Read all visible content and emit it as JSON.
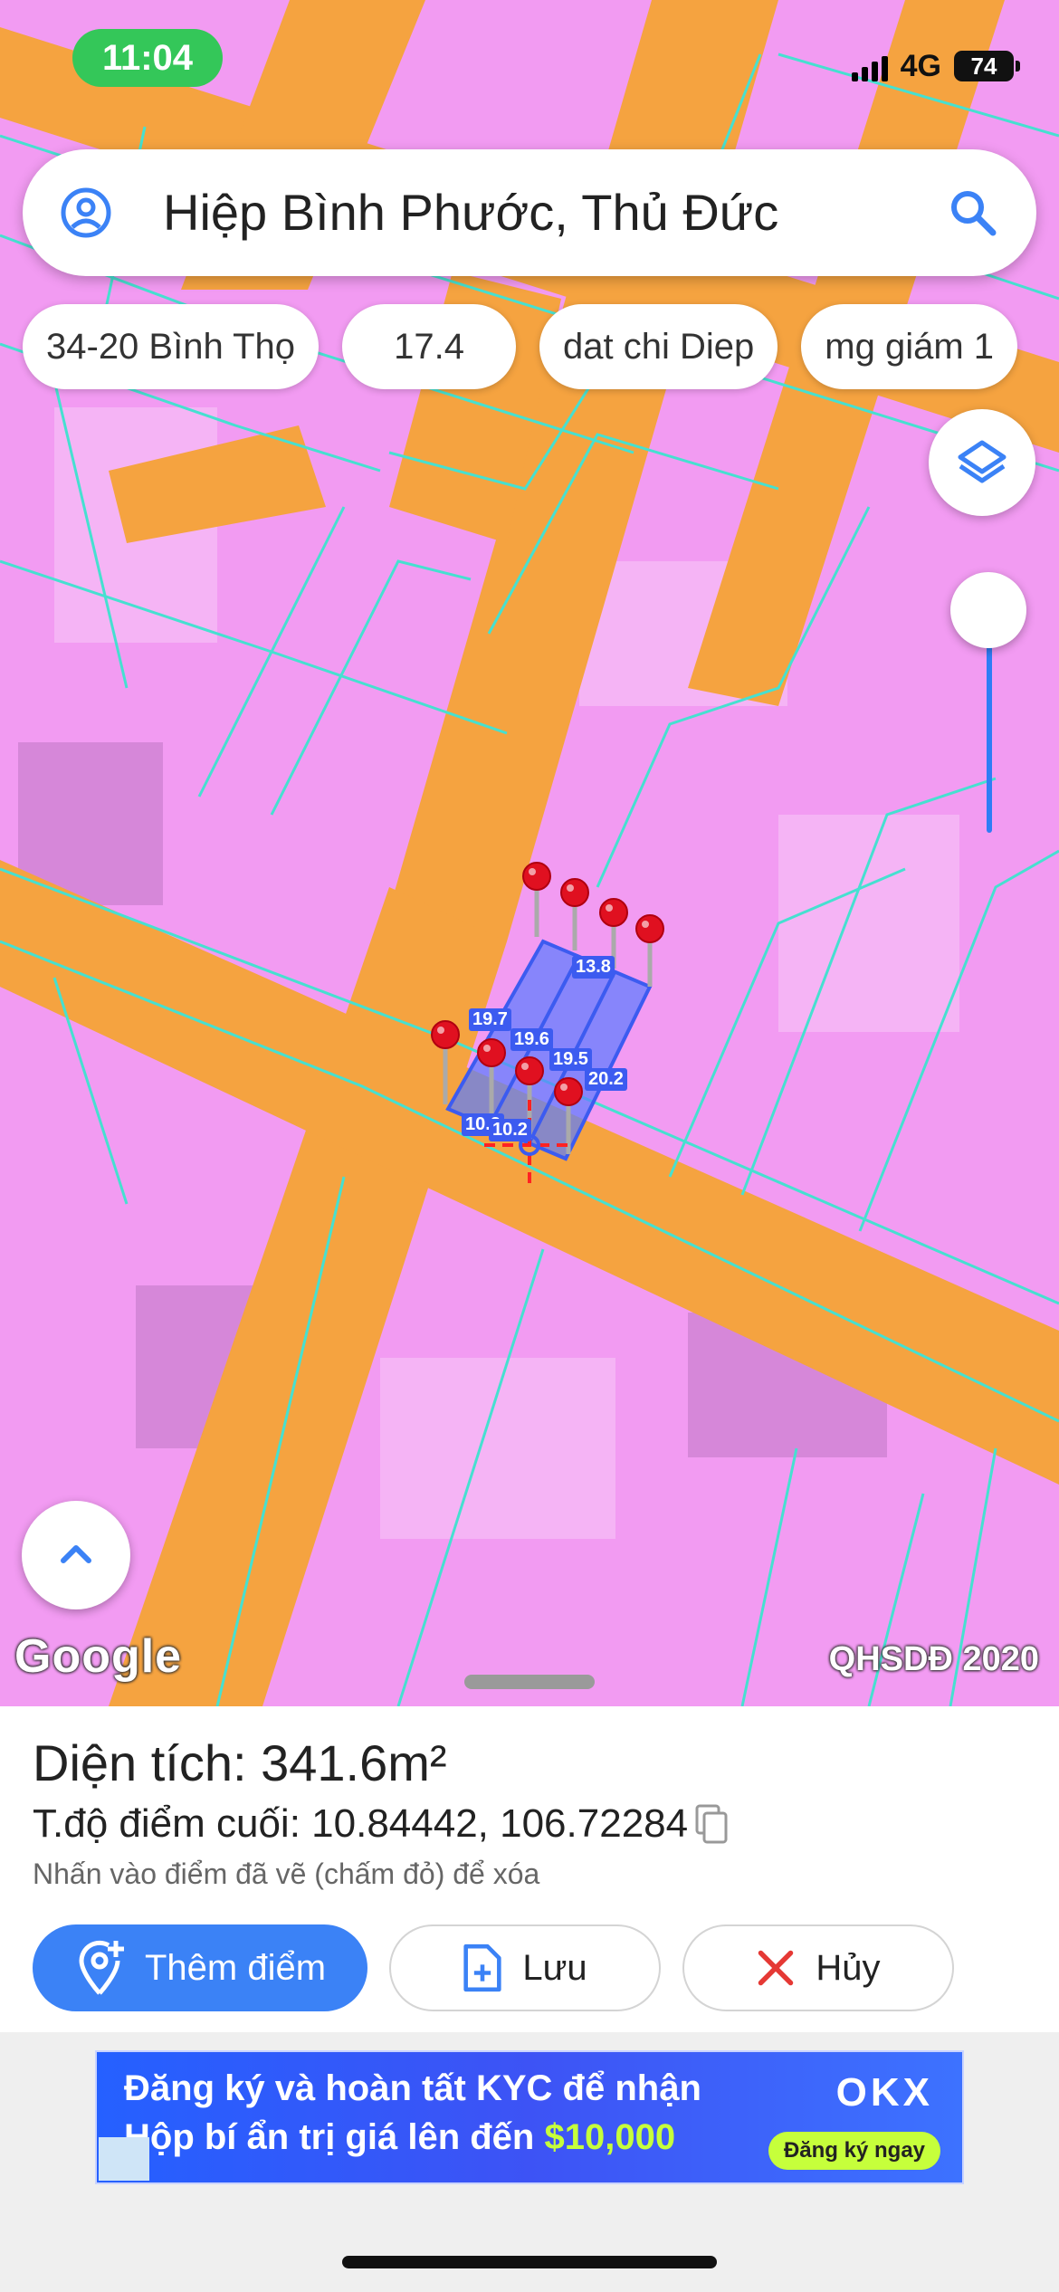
{
  "status_bar": {
    "time": "11:04",
    "network": "4G",
    "battery": "74"
  },
  "search": {
    "query": "Hiệp Bình Phước, Thủ Đức",
    "avatar_icon": "account-circle-icon",
    "search_icon": "search-icon"
  },
  "chips": [
    "34-20 Bình Thọ",
    "17.4",
    "dat chi Diep",
    "mg giám 1"
  ],
  "map": {
    "layers_icon": "layers-icon",
    "logo": "Google",
    "layer_name": "QHSDĐ 2020",
    "colors": {
      "residential": "#f29bf2",
      "road": "#f5a340",
      "parcel_lines": "#46e0d0",
      "polygon": "#5a7cff",
      "pin": "#e01020"
    },
    "edge_labels": [
      "13.8",
      "19.7",
      "19.6",
      "19.5",
      "20.2",
      "10.2",
      "10.2"
    ]
  },
  "panel": {
    "area_label": "Diện tích: 341.6m²",
    "coord_label": "T.độ điểm cuối: 10.84442, 106.72284",
    "copy_icon": "copy-icon",
    "hint": "Nhấn vào điểm đã vẽ (chấm đỏ) để xóa",
    "add_button": "Thêm điểm",
    "save_button": "Lưu",
    "cancel_button": "Hủy"
  },
  "ad": {
    "line1": "Đăng ký và hoàn tất KYC để nhận",
    "line2_prefix": "Hộp bí ẩn trị giá lên đến ",
    "amount": "$10,000",
    "brand": "OKX",
    "cta": "Đăng ký ngay"
  }
}
